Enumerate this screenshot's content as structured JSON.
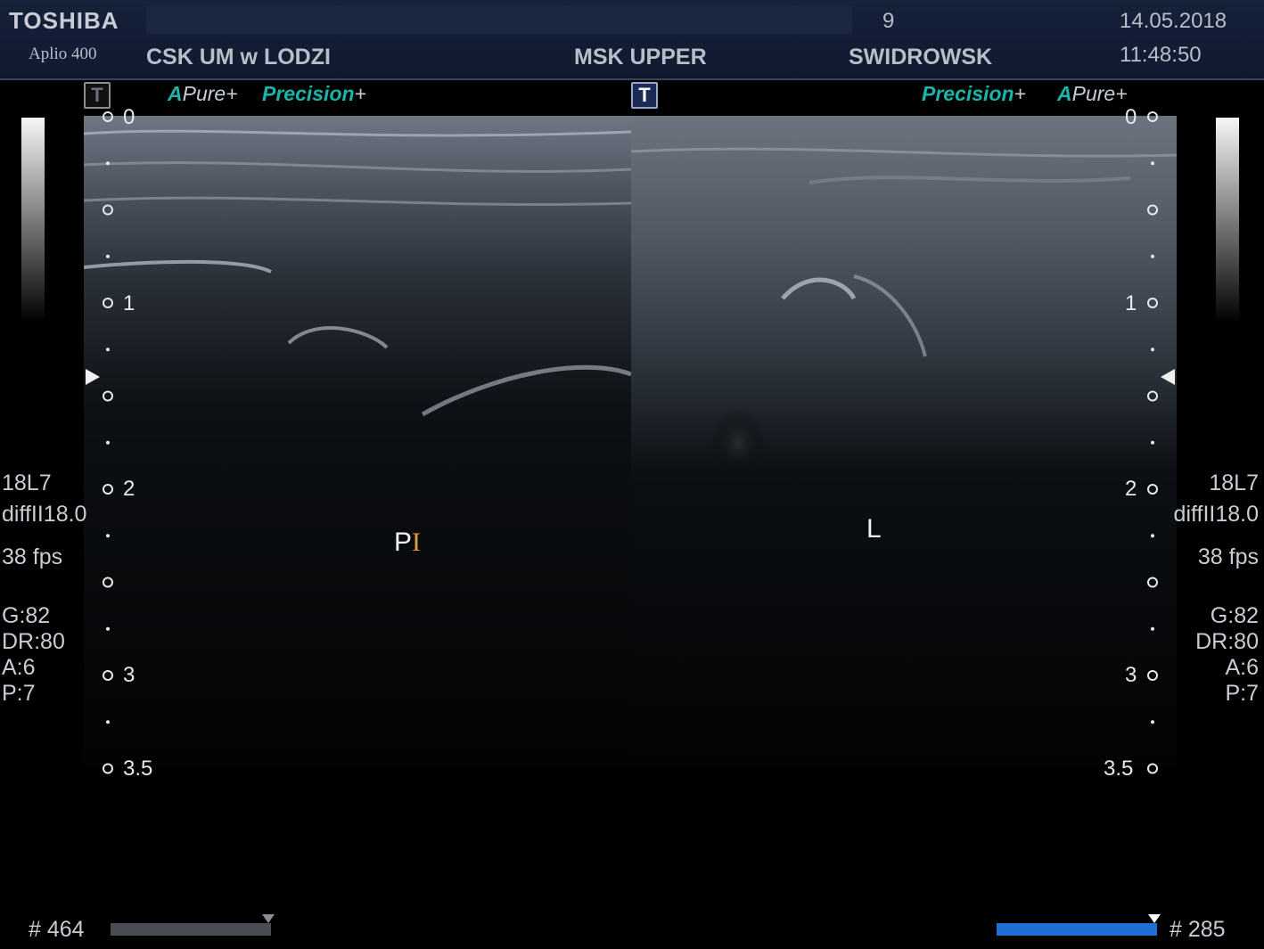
{
  "header": {
    "brand": "TOSHIBA",
    "model": "Aplio 400",
    "institution": "CSK UM w LODZI",
    "exam_number": "9",
    "preset": "MSK UPPER",
    "patient": "SWIDROWSK",
    "date": "14.05.2018",
    "time": "11:48:50"
  },
  "left_pane": {
    "t_button": "T",
    "mode_a": "A",
    "mode_pure": "Pure",
    "mode_precision": "Precision",
    "plus": "+",
    "depth_labels": [
      "0",
      "1",
      "2",
      "3",
      "3.5"
    ],
    "params": {
      "probe": "18L7",
      "freq": "diffII18.0",
      "fps": "38 fps",
      "gain": "G:82",
      "dr": "DR:80",
      "a": "A:6",
      "p": "P:7"
    },
    "annotation": "P",
    "annotation_cursor": "I",
    "frame_counter": "# 464",
    "cine_fill": 1.0
  },
  "right_pane": {
    "t_button": "T",
    "mode_a": "A",
    "mode_pure": "Pure",
    "mode_precision": "Precision",
    "plus": "+",
    "depth_labels": [
      "0",
      "1",
      "2",
      "3",
      "3.5"
    ],
    "params": {
      "probe": "18L7",
      "freq": "diffII18.0",
      "fps": "38 fps",
      "gain": "G:82",
      "dr": "DR:80",
      "a": "A:6",
      "p": "P:7"
    },
    "annotation": "L",
    "frame_counter": "# 285",
    "cine_fill": 1.0
  },
  "colors": {
    "header_bg": "#16213a",
    "mode_accent": "#1ab5a8",
    "cine_left": "#4a4d54",
    "cine_right": "#1f6fd6",
    "cursor": "#e0a030"
  }
}
